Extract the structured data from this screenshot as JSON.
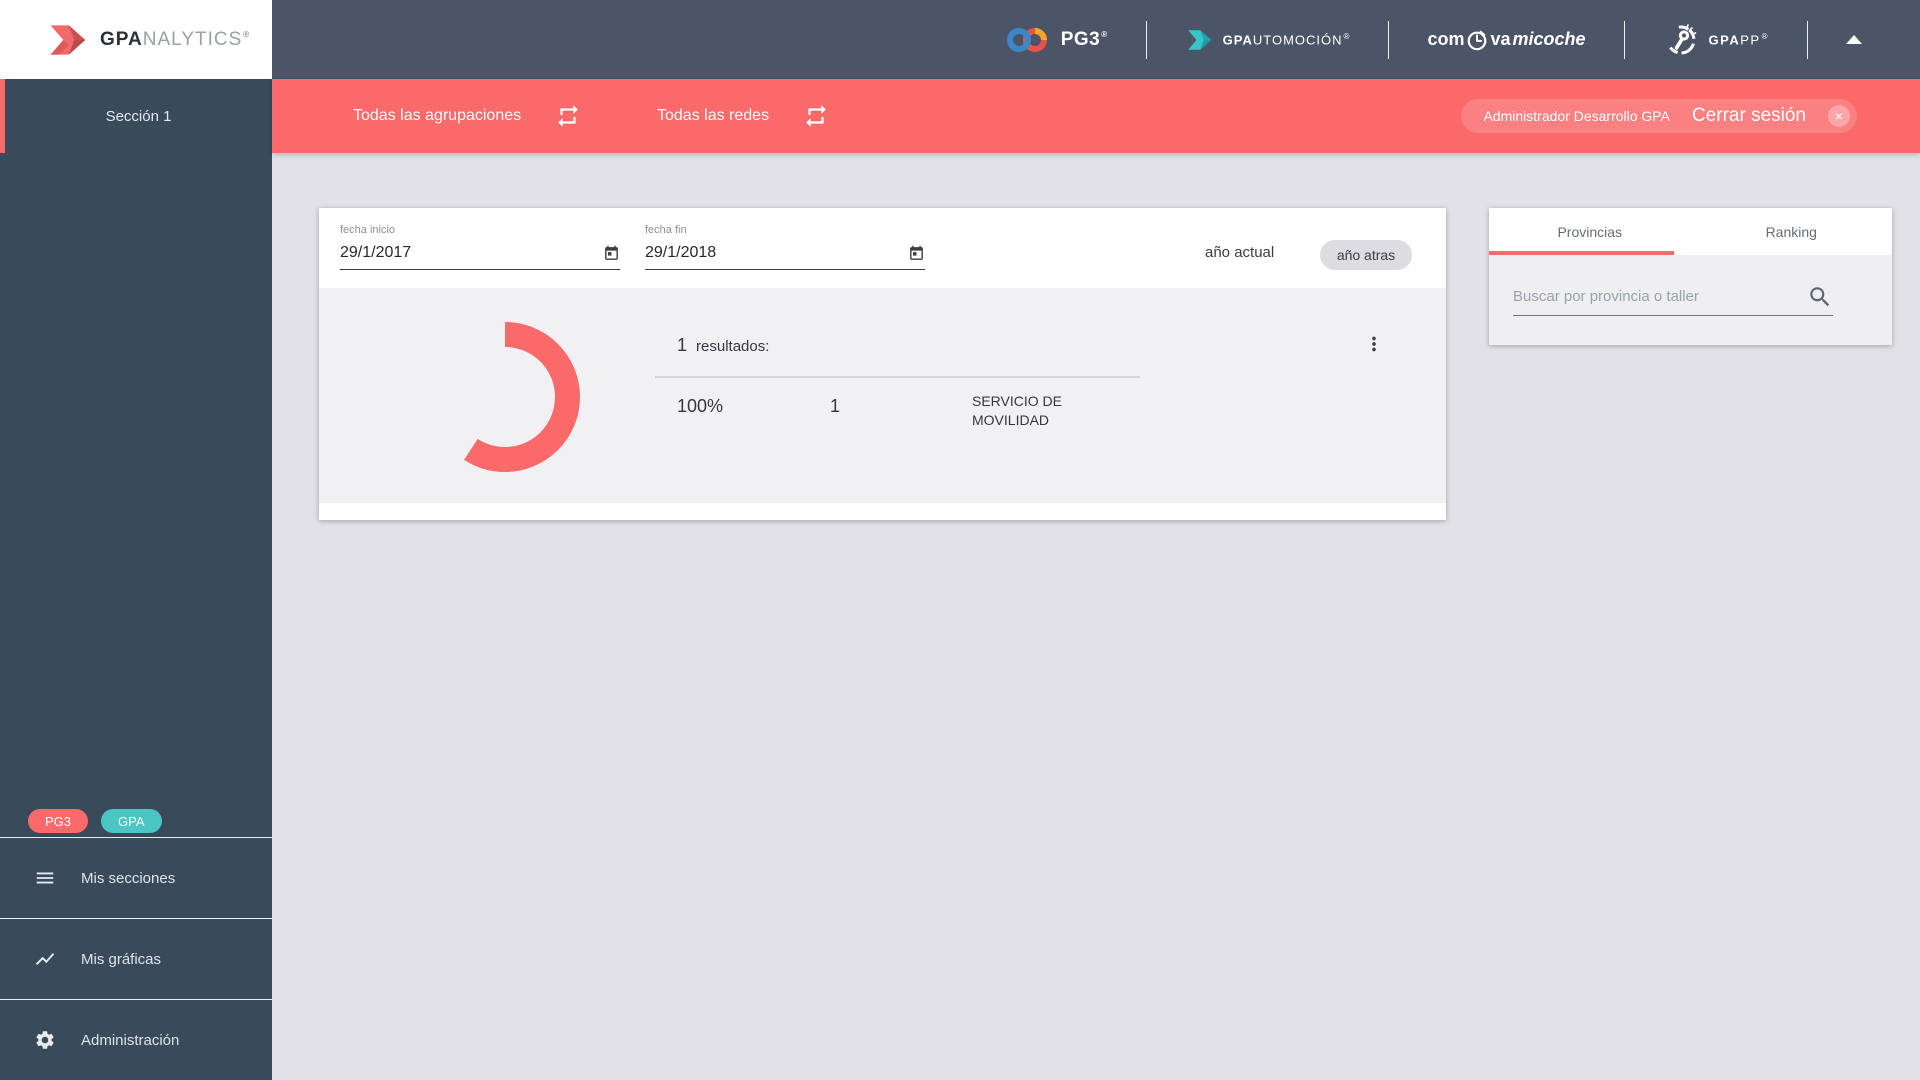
{
  "app": {
    "logo_bold": "GPA",
    "logo_rest": "NALYTICS",
    "logo_reg": "®"
  },
  "header": {
    "pg3_label": "PG3",
    "pg3_reg": "®",
    "automocion_bold": "GPA",
    "automocion_rest": "UTOMOCIÓN",
    "automocion_reg": "®",
    "coche_part1": "com",
    "coche_part2": "va",
    "coche_part3": "micoche",
    "gpapp_bold": "GPA",
    "gpapp_rest": "PP",
    "gpapp_reg": "®"
  },
  "toolbar": {
    "agrupaciones_label": "Todas las agrupaciones",
    "redes_label": "Todas las redes",
    "user_name": "Administrador Desarrollo GPA",
    "logout_label": "Cerrar sesión",
    "logout_close": "×"
  },
  "sidebar": {
    "section_label": "Sección 1",
    "badge_pg3": "PG3",
    "badge_gpa": "GPA",
    "menu_secciones": "Mis secciones",
    "menu_graficas": "Mis gráficas",
    "menu_admin": "Administración"
  },
  "filters": {
    "fecha_inicio_label": "fecha inicio",
    "fecha_inicio_value": "29/1/2017",
    "fecha_fin_label": "fecha fin",
    "fecha_fin_value": "29/1/2018",
    "ano_actual_label": "año actual",
    "ano_atras_label": "año atras"
  },
  "results": {
    "count": "1",
    "label": "resultados:",
    "row_percent": "100%",
    "row_count": "1",
    "row_name": "SERVICIO DE MOVILIDAD"
  },
  "panel": {
    "tab_provincias": "Provincias",
    "tab_ranking": "Ranking",
    "search_placeholder": "Buscar por provincia o taller"
  },
  "chart_data": {
    "type": "pie",
    "donut": true,
    "series": [
      {
        "label": "SERVICIO DE MOVILIDAD",
        "percent": 100,
        "count": 1
      }
    ],
    "colors": [
      "#fb6a6b"
    ],
    "visible_sweep_deg": 213,
    "legend_position": "right",
    "title": "1 resultados:"
  },
  "colors": {
    "accent_red": "#fb6a6b",
    "teal": "#4cc5c5",
    "header_dark": "#4b5567",
    "sidebar_dark": "#394a5a",
    "page_bg": "#e2e1e6",
    "card_gray": "#f1f1f4"
  }
}
